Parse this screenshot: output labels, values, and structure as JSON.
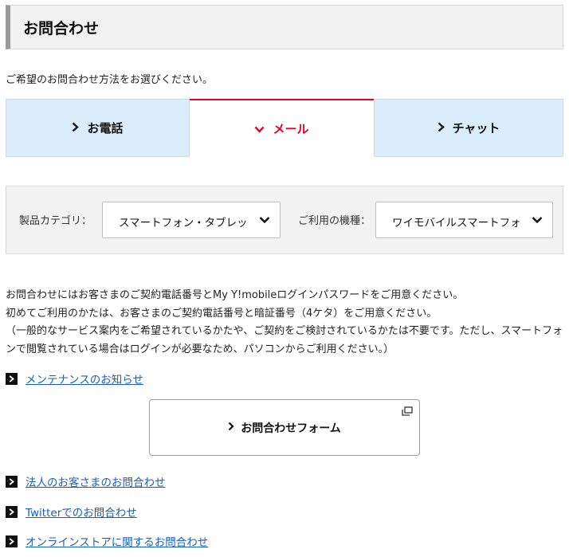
{
  "header": {
    "title": "お問合わせ"
  },
  "intro": "ご希望のお問合わせ方法をお選びください。",
  "tabs": [
    {
      "label": "お電話",
      "active": false
    },
    {
      "label": "メール",
      "active": true
    },
    {
      "label": "チャット",
      "active": false
    }
  ],
  "filter": {
    "category_label": "製品カテゴリ：",
    "category_value": "スマートフォン・タブレット",
    "device_label": "ご利用の機種：",
    "device_value": "ワイモバイルスマートフォン"
  },
  "notes": {
    "line1": "お問合わせにはお客さまのご契約電話番号とMy Y!mobileログインパスワードをご用意ください。",
    "line2": "初めてご利用のかたは、お客さまのご契約電話番号と暗証番号（4ケタ）をご用意ください。",
    "line3": "（一般的なサービス案内をご希望されているかたや、ご契約をご検討されているかたは不要です。ただし、スマートフォンで閲覧されている場合はログインが必要なため、パソコンからご利用ください。）"
  },
  "links": {
    "maintenance": "メンテナンスのお知らせ",
    "corporate": "法人のお客さまのお問合わせ",
    "twitter": "Twitterでのお問合わせ",
    "online_store": "オンラインストアに関するお問合わせ"
  },
  "form_button": {
    "label": "お問合わせフォーム"
  },
  "colors": {
    "accent": "#e4002b",
    "tab_bg": "#dbedfb",
    "link": "#1a5fb4"
  }
}
